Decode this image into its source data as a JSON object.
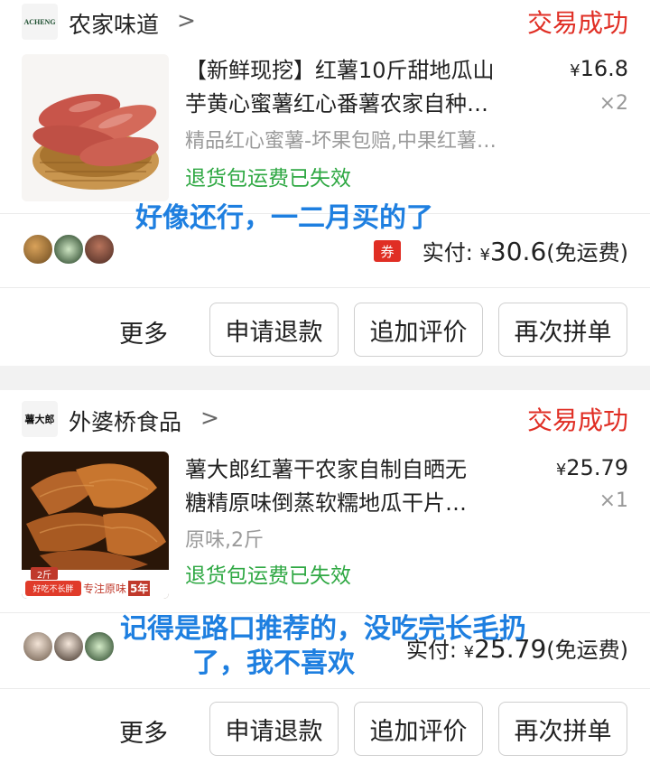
{
  "orders": [
    {
      "store": {
        "name": "农家味道",
        "logo_text": "ACHENG",
        "chevron": ">"
      },
      "status": "交易成功",
      "product": {
        "title_line1": "【新鲜现挖】红薯10斤甜地瓜山",
        "title_line2": "芋黄心蜜薯红心番薯农家自种…",
        "price_symbol": "¥",
        "price": "16.8",
        "qty": "×2",
        "spec": "精品红心蜜薯-坏果包赔,中果红薯…",
        "refund_note": "退货包运费已失效"
      },
      "annotation_lines": [
        "好像还行，一二月买的了"
      ],
      "payment": {
        "coupon_label": "券",
        "label": "实付:",
        "symbol": "¥",
        "amount": "30.6",
        "shipping": "(免运费)"
      },
      "actions": {
        "more": "更多",
        "refund": "申请退款",
        "review": "追加评价",
        "rebuy": "再次拼单"
      }
    },
    {
      "store": {
        "name": "外婆桥食品",
        "logo_text": "薯大郎",
        "chevron": ">"
      },
      "status": "交易成功",
      "product": {
        "title_line1": "薯大郎红薯干农家自制自晒无",
        "title_line2": "糖精原味倒蒸软糯地瓜干片…",
        "price_symbol": "¥",
        "price": "25.79",
        "qty": "×1",
        "spec": "原味,2斤",
        "refund_note": "退货包运费已失效",
        "thumb_badge_weight": "2斤",
        "thumb_badge_slogan": "好吃不长胖",
        "thumb_badge_text": "专注原味",
        "thumb_badge_years": "5年"
      },
      "annotation_lines": [
        "记得是路口推荐的，没吃完长毛扔",
        "了，我不喜欢"
      ],
      "payment": {
        "label": "实付:",
        "symbol": "¥",
        "amount": "25.79",
        "shipping": "(免运费)"
      },
      "actions": {
        "more": "更多",
        "refund": "申请退款",
        "review": "追加评价",
        "rebuy": "再次拼单"
      }
    }
  ]
}
